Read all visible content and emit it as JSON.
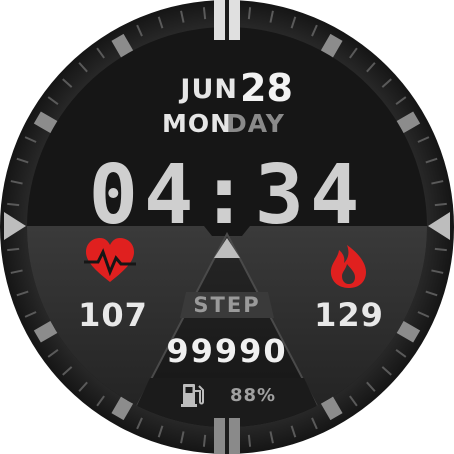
{
  "date": {
    "month": "JUN",
    "day": "28",
    "weekday_part1": "MON",
    "weekday_part2": "DAY"
  },
  "time": "04:34",
  "heart_rate": {
    "value": "107",
    "icon": "heart-rate-icon",
    "color": "#e0201f"
  },
  "calories": {
    "value": "129",
    "icon": "flame-icon",
    "color": "#e0201f"
  },
  "steps": {
    "label": "STEP",
    "value": "99990"
  },
  "battery": {
    "value": "88%",
    "icon": "fuel-pump-icon"
  }
}
